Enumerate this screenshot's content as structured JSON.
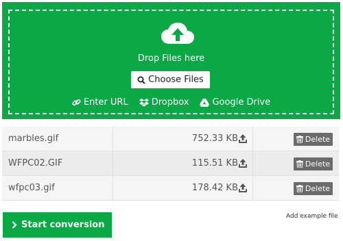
{
  "dropzone": {
    "title": "Drop Files here",
    "choose_label": "Choose Files",
    "sources": [
      {
        "label": "Enter URL",
        "icon": "link-icon"
      },
      {
        "label": "Dropbox",
        "icon": "dropbox-icon"
      },
      {
        "label": "Google Drive",
        "icon": "google-drive-icon"
      }
    ],
    "color": "#0ba846"
  },
  "files": [
    {
      "name": "marbles.gif",
      "size": "752.33 KB",
      "delete_label": "Delete"
    },
    {
      "name": "WFPC02.GIF",
      "size": "115.51 KB",
      "delete_label": "Delete"
    },
    {
      "name": "wfpc03.gif",
      "size": "178.42 KB",
      "delete_label": "Delete"
    }
  ],
  "actions": {
    "start_label": "Start conversion",
    "add_example_label": "Add example file"
  }
}
